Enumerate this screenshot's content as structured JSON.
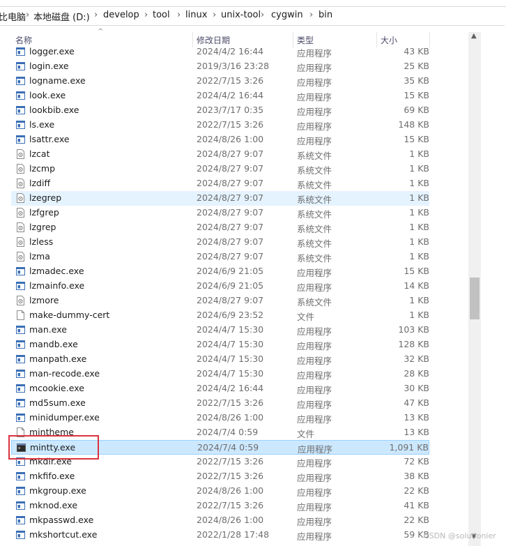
{
  "breadcrumb": [
    "比电脑",
    "本地磁盘 (D:)",
    "develop",
    "tool",
    "linux",
    "unix-tool",
    "cygwin",
    "bin"
  ],
  "breadcrumb_separator": "›",
  "columns": {
    "name": "名称",
    "modified": "修改日期",
    "type": "类型",
    "size": "大小"
  },
  "files": [
    {
      "name": "logger.exe",
      "modified": "2024/4/2 16:44",
      "type": "应用程序",
      "size": "43 KB",
      "icon": "exe"
    },
    {
      "name": "login.exe",
      "modified": "2019/3/16 23:28",
      "type": "应用程序",
      "size": "25 KB",
      "icon": "exe"
    },
    {
      "name": "logname.exe",
      "modified": "2022/7/15 3:26",
      "type": "应用程序",
      "size": "35 KB",
      "icon": "exe"
    },
    {
      "name": "look.exe",
      "modified": "2024/4/2 16:44",
      "type": "应用程序",
      "size": "15 KB",
      "icon": "exe"
    },
    {
      "name": "lookbib.exe",
      "modified": "2023/7/17 0:35",
      "type": "应用程序",
      "size": "69 KB",
      "icon": "exe"
    },
    {
      "name": "ls.exe",
      "modified": "2022/7/15 3:26",
      "type": "应用程序",
      "size": "148 KB",
      "icon": "exe"
    },
    {
      "name": "lsattr.exe",
      "modified": "2024/8/26 1:00",
      "type": "应用程序",
      "size": "15 KB",
      "icon": "exe"
    },
    {
      "name": "lzcat",
      "modified": "2024/8/27 9:07",
      "type": "系统文件",
      "size": "1 KB",
      "icon": "system"
    },
    {
      "name": "lzcmp",
      "modified": "2024/8/27 9:07",
      "type": "系统文件",
      "size": "1 KB",
      "icon": "system"
    },
    {
      "name": "lzdiff",
      "modified": "2024/8/27 9:07",
      "type": "系统文件",
      "size": "1 KB",
      "icon": "system"
    },
    {
      "name": "lzegrep",
      "modified": "2024/8/27 9:07",
      "type": "系统文件",
      "size": "1 KB",
      "icon": "system",
      "state": "hover"
    },
    {
      "name": "lzfgrep",
      "modified": "2024/8/27 9:07",
      "type": "系统文件",
      "size": "1 KB",
      "icon": "system"
    },
    {
      "name": "lzgrep",
      "modified": "2024/8/27 9:07",
      "type": "系统文件",
      "size": "1 KB",
      "icon": "system"
    },
    {
      "name": "lzless",
      "modified": "2024/8/27 9:07",
      "type": "系统文件",
      "size": "1 KB",
      "icon": "system"
    },
    {
      "name": "lzma",
      "modified": "2024/8/27 9:07",
      "type": "系统文件",
      "size": "1 KB",
      "icon": "system"
    },
    {
      "name": "lzmadec.exe",
      "modified": "2024/6/9 21:05",
      "type": "应用程序",
      "size": "15 KB",
      "icon": "exe"
    },
    {
      "name": "lzmainfo.exe",
      "modified": "2024/6/9 21:05",
      "type": "应用程序",
      "size": "14 KB",
      "icon": "exe"
    },
    {
      "name": "lzmore",
      "modified": "2024/8/27 9:07",
      "type": "系统文件",
      "size": "1 KB",
      "icon": "system"
    },
    {
      "name": "make-dummy-cert",
      "modified": "2024/6/9 23:52",
      "type": "文件",
      "size": "1 KB",
      "icon": "file"
    },
    {
      "name": "man.exe",
      "modified": "2024/4/7 15:30",
      "type": "应用程序",
      "size": "103 KB",
      "icon": "exe"
    },
    {
      "name": "mandb.exe",
      "modified": "2024/4/7 15:30",
      "type": "应用程序",
      "size": "128 KB",
      "icon": "exe"
    },
    {
      "name": "manpath.exe",
      "modified": "2024/4/7 15:30",
      "type": "应用程序",
      "size": "32 KB",
      "icon": "exe"
    },
    {
      "name": "man-recode.exe",
      "modified": "2024/4/7 15:30",
      "type": "应用程序",
      "size": "28 KB",
      "icon": "exe"
    },
    {
      "name": "mcookie.exe",
      "modified": "2024/4/2 16:44",
      "type": "应用程序",
      "size": "30 KB",
      "icon": "exe"
    },
    {
      "name": "md5sum.exe",
      "modified": "2022/7/15 3:26",
      "type": "应用程序",
      "size": "47 KB",
      "icon": "exe"
    },
    {
      "name": "minidumper.exe",
      "modified": "2024/8/26 1:00",
      "type": "应用程序",
      "size": "13 KB",
      "icon": "exe"
    },
    {
      "name": "mintheme",
      "modified": "2024/7/4 0:59",
      "type": "文件",
      "size": "13 KB",
      "icon": "file"
    },
    {
      "name": "mintty.exe",
      "modified": "2024/7/4 0:59",
      "type": "应用程序",
      "size": "1,091 KB",
      "icon": "terminal",
      "state": "selected"
    },
    {
      "name": "mkdir.exe",
      "modified": "2022/7/15 3:26",
      "type": "应用程序",
      "size": "72 KB",
      "icon": "exe"
    },
    {
      "name": "mkfifo.exe",
      "modified": "2022/7/15 3:26",
      "type": "应用程序",
      "size": "38 KB",
      "icon": "exe"
    },
    {
      "name": "mkgroup.exe",
      "modified": "2024/8/26 1:00",
      "type": "应用程序",
      "size": "22 KB",
      "icon": "exe"
    },
    {
      "name": "mknod.exe",
      "modified": "2022/7/15 3:26",
      "type": "应用程序",
      "size": "41 KB",
      "icon": "exe"
    },
    {
      "name": "mkpasswd.exe",
      "modified": "2024/8/26 1:00",
      "type": "应用程序",
      "size": "22 KB",
      "icon": "exe"
    },
    {
      "name": "mkshortcut.exe",
      "modified": "2022/1/28 17:48",
      "type": "应用程序",
      "size": "59 KB",
      "icon": "exe"
    }
  ],
  "watermark": "CSDN @solutionier",
  "colors": {
    "hover": "#e5f3ff",
    "selected": "#cce8ff",
    "annotation_box": "#d9333f"
  }
}
